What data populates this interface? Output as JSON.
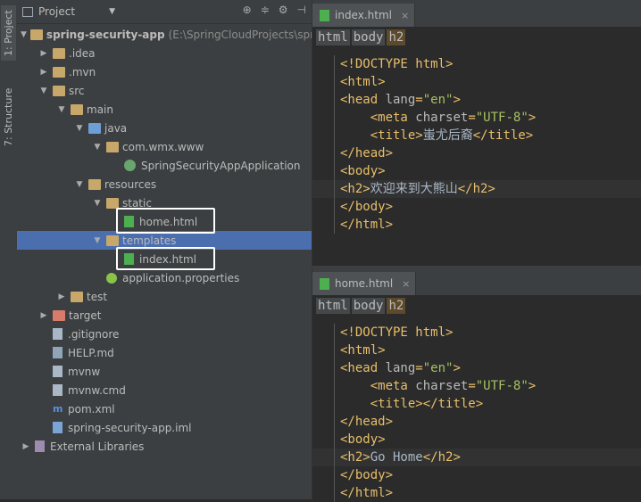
{
  "side_tabs": {
    "project": "1: Project",
    "structure": "7: Structure"
  },
  "project_panel": {
    "title": "Project",
    "tools": [
      "⊕",
      "≑",
      "⚙",
      "⊣"
    ]
  },
  "tree": [
    {
      "label": "spring-security-app",
      "extra": "(E:\\SpringCloudProjects\\spri",
      "icon": "folder-module",
      "depth": 0,
      "arrow": "down",
      "bold": true
    },
    {
      "label": ".idea",
      "icon": "folder",
      "depth": 1,
      "arrow": "right"
    },
    {
      "label": ".mvn",
      "icon": "folder",
      "depth": 1,
      "arrow": "right"
    },
    {
      "label": "src",
      "icon": "folder",
      "depth": 1,
      "arrow": "down"
    },
    {
      "label": "main",
      "icon": "folder",
      "depth": 2,
      "arrow": "down"
    },
    {
      "label": "java",
      "icon": "folder-blue",
      "depth": 3,
      "arrow": "down"
    },
    {
      "label": "com.wmx.www",
      "icon": "folder-package",
      "depth": 4,
      "arrow": "down"
    },
    {
      "label": "SpringSecurityAppApplication",
      "icon": "spring-class",
      "depth": 5,
      "arrow": ""
    },
    {
      "label": "resources",
      "icon": "folder-resources",
      "depth": 3,
      "arrow": "down"
    },
    {
      "label": "static",
      "icon": "folder",
      "depth": 4,
      "arrow": "down"
    },
    {
      "label": "home.html",
      "icon": "html-file",
      "depth": 5,
      "arrow": "",
      "boxed": true
    },
    {
      "label": "templates",
      "icon": "folder",
      "depth": 4,
      "arrow": "down",
      "selected": true
    },
    {
      "label": "index.html",
      "icon": "html-file",
      "depth": 5,
      "arrow": "",
      "boxed": true
    },
    {
      "label": "application.properties",
      "icon": "properties-file",
      "depth": 4,
      "arrow": ""
    },
    {
      "label": "test",
      "icon": "folder",
      "depth": 2,
      "arrow": "right"
    },
    {
      "label": "target",
      "icon": "folder-excluded",
      "depth": 1,
      "arrow": "right"
    },
    {
      "label": ".gitignore",
      "icon": "text-file",
      "depth": 1,
      "arrow": ""
    },
    {
      "label": "HELP.md",
      "icon": "md-file",
      "depth": 1,
      "arrow": ""
    },
    {
      "label": "mvnw",
      "icon": "text-file",
      "depth": 1,
      "arrow": ""
    },
    {
      "label": "mvnw.cmd",
      "icon": "text-file",
      "depth": 1,
      "arrow": ""
    },
    {
      "label": "pom.xml",
      "icon": "maven-file",
      "depth": 1,
      "arrow": ""
    },
    {
      "label": "spring-security-app.iml",
      "icon": "iml-file",
      "depth": 1,
      "arrow": ""
    },
    {
      "label": "External Libraries",
      "icon": "library",
      "depth": 0,
      "arrow": "right"
    }
  ],
  "editor_top": {
    "tab": "index.html",
    "breadcrumbs": [
      "html",
      "body",
      "h2"
    ],
    "lines": [
      "<!DOCTYPE html>",
      "<html>",
      "<head lang=\"en\">",
      "    <meta charset=\"UTF-8\">",
      "    <title>蚩尤后裔</title>",
      "</head>",
      "<body>",
      "<h2>欢迎来到大熊山</h2>",
      "</body>",
      "</html>"
    ],
    "current_line": 7
  },
  "editor_bottom": {
    "tab": "home.html",
    "breadcrumbs": [
      "html",
      "body",
      "h2"
    ],
    "lines": [
      "<!DOCTYPE html>",
      "<html>",
      "<head lang=\"en\">",
      "    <meta charset=\"UTF-8\">",
      "    <title></title>",
      "</head>",
      "<body>",
      "<h2>Go Home</h2>",
      "</body>",
      "</html>"
    ],
    "current_line": 7
  },
  "colors": {
    "selection": "#4b6eaf",
    "tag": "#e8bf6a",
    "text": "#a9b7c6",
    "string": "#a5c261"
  }
}
